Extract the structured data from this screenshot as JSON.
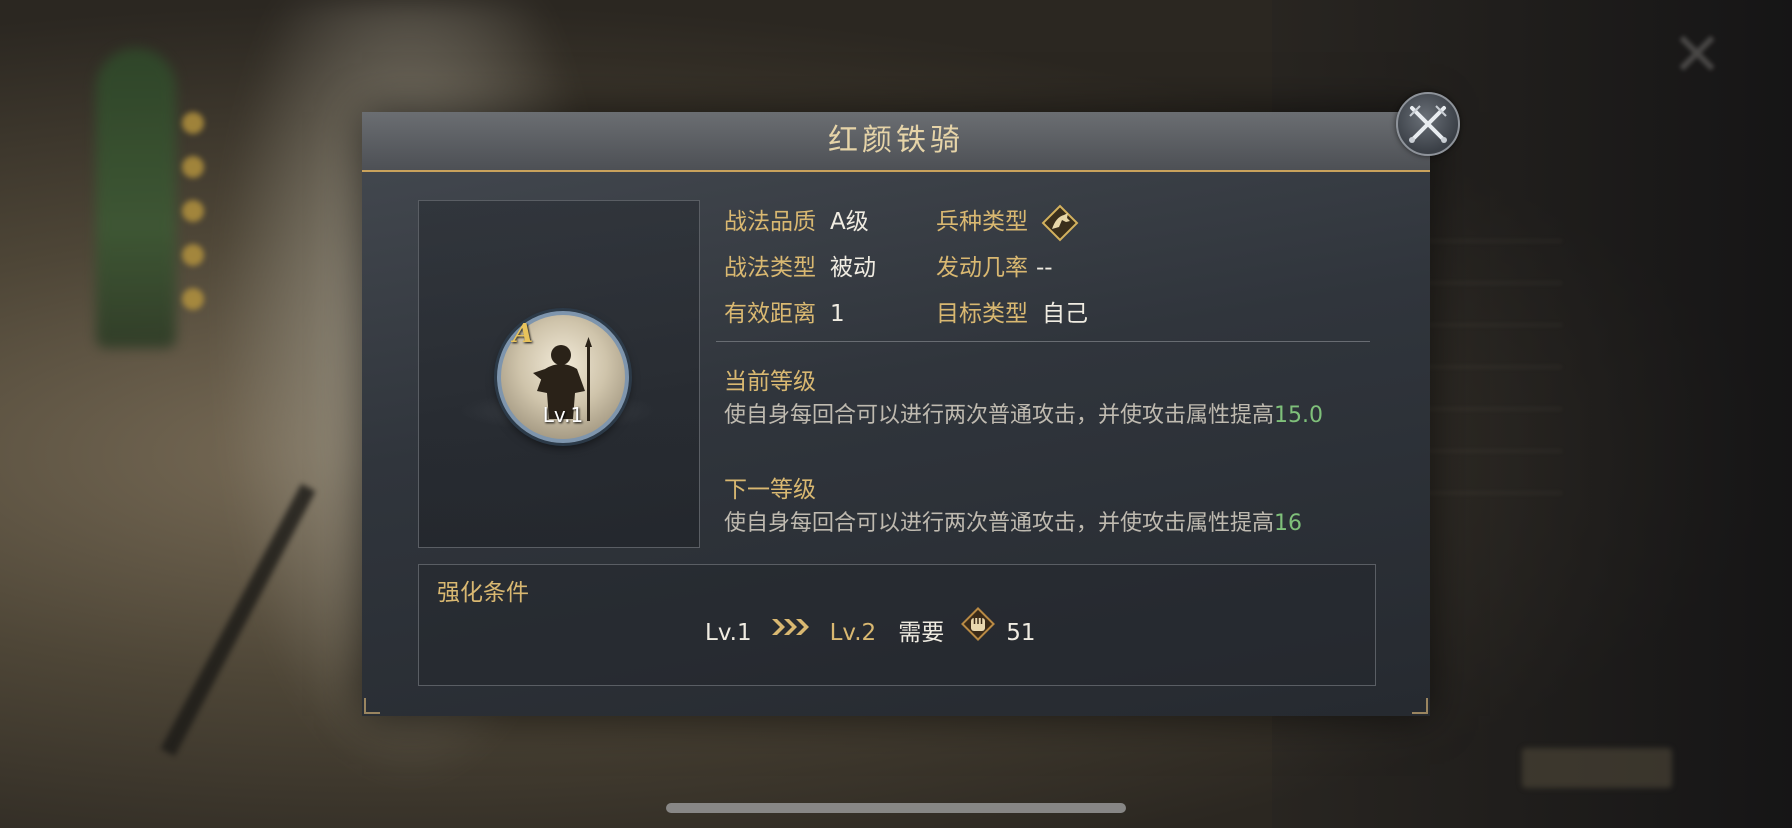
{
  "dialog": {
    "title": "红颜铁骑",
    "close_icon": "crossed-swords-close-icon"
  },
  "skill": {
    "grade": "A",
    "level": "Lv.1",
    "icon": "warrior-silhouette-icon"
  },
  "info": {
    "quality_label": "战法品质",
    "quality_value": "A级",
    "troop_label": "兵种类型",
    "troop_icon": "cavalry-horse-icon",
    "type_label": "战法类型",
    "type_value": "被动",
    "chance_label": "发动几率",
    "chance_value": "--",
    "range_label": "有效距离",
    "range_value": "1",
    "target_label": "目标类型",
    "target_value": "自己"
  },
  "current": {
    "title": "当前等级",
    "desc_text": "使自身每回合可以进行两次普通攻击，并使攻击属性提高",
    "desc_value": "15.0"
  },
  "next": {
    "title": "下一等级",
    "desc_text": "使自身每回合可以进行两次普通攻击，并使攻击属性提高",
    "desc_value": "16"
  },
  "upgrade": {
    "title": "强化条件",
    "from_level": "Lv.1",
    "to_level": "Lv.2",
    "need_label": "需要",
    "cost_icon": "fist-token-icon",
    "cost_value": "51"
  },
  "colors": {
    "gold_label": "#d9b871",
    "value_green": "#7fc07a",
    "header_rule": "#c9a25c"
  }
}
